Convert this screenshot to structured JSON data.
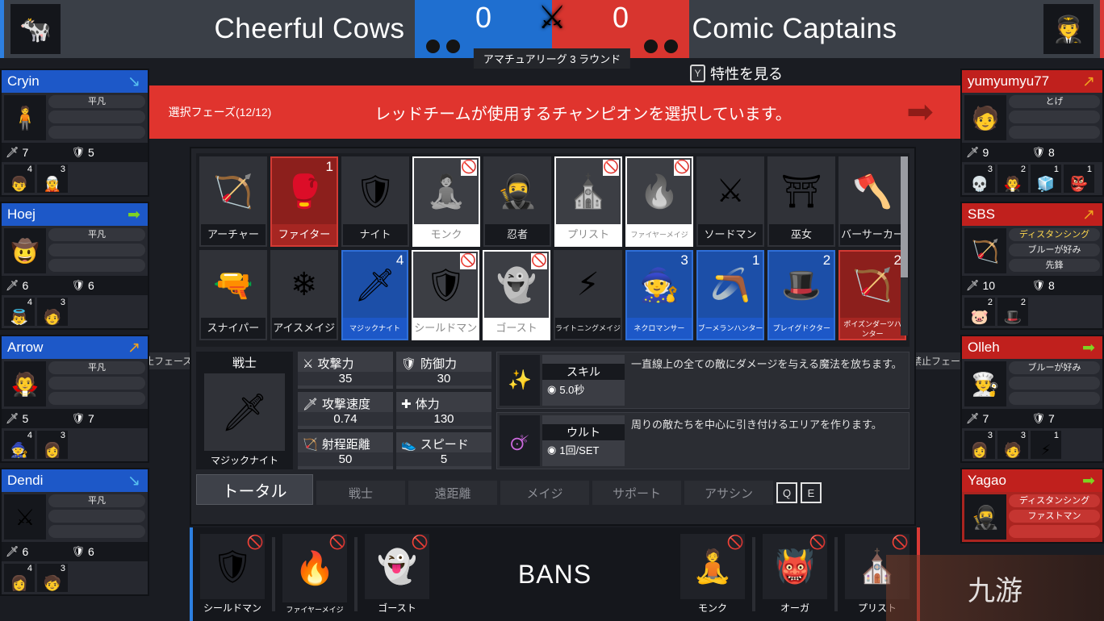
{
  "header": {
    "blue_team": "Cheerful Cows",
    "red_team": "Comic Captains",
    "blue_logo_icon": "cow-icon",
    "red_logo_icon": "captain-icon",
    "blue_score": "0",
    "red_score": "0",
    "swords_icon": "crossed-swords-icon",
    "league_label": "アマチュアリーグ 3 ラウンド",
    "trait_hint_key": "Y",
    "trait_hint_label": "特性を見る"
  },
  "phase": {
    "label": "選択フェーズ(12/12)",
    "message": "レッドチームが使用するチャンピオンを選択しています。",
    "arrow_icon": "arrow-right-icon",
    "ban_phase_tag": "禁止フェーズ"
  },
  "colors": {
    "blue": "#1d58c8",
    "red": "#c0201d",
    "banner_red": "#e0342e",
    "panel_dark": "#22242a"
  },
  "blue_players": [
    {
      "name": "Cryin",
      "arrow": "↘",
      "arrow_color": "#58c0f0",
      "traits": [
        "平凡",
        "",
        ""
      ],
      "atk": "7",
      "def": "5",
      "portrait": "🧍",
      "units": [
        {
          "icon": "👦",
          "count": "4"
        },
        {
          "icon": "🧝",
          "count": "3"
        }
      ]
    },
    {
      "name": "Hoej",
      "arrow": "➡",
      "arrow_color": "#7ed321",
      "traits": [
        "平凡",
        "",
        ""
      ],
      "atk": "6",
      "def": "6",
      "portrait": "🤠",
      "units": [
        {
          "icon": "👼",
          "count": "4"
        },
        {
          "icon": "🧑",
          "count": "3"
        }
      ]
    },
    {
      "name": "Arrow",
      "arrow": "↗",
      "arrow_color": "#f0a21e",
      "traits": [
        "平凡",
        "",
        ""
      ],
      "atk": "5",
      "def": "7",
      "portrait": "🧛",
      "units": [
        {
          "icon": "🧙",
          "count": "4"
        },
        {
          "icon": "👩",
          "count": "3"
        }
      ]
    },
    {
      "name": "Dendi",
      "arrow": "↘",
      "arrow_color": "#58c0f0",
      "traits": [
        "平凡",
        "",
        ""
      ],
      "atk": "6",
      "def": "6",
      "portrait": "⚔",
      "units": [
        {
          "icon": "👩",
          "count": "4"
        },
        {
          "icon": "🧒",
          "count": "3"
        }
      ]
    }
  ],
  "red_players": [
    {
      "name": "yumyumyu77",
      "arrow": "↗",
      "arrow_color": "#f0a21e",
      "traits": [
        "とげ",
        "",
        ""
      ],
      "atk": "9",
      "def": "8",
      "portrait": "🧑",
      "active": false,
      "units": [
        {
          "icon": "💀",
          "count": "3"
        },
        {
          "icon": "🧛",
          "count": "2"
        },
        {
          "icon": "🧊",
          "count": "1"
        },
        {
          "icon": "👺",
          "count": "1"
        }
      ]
    },
    {
      "name": "SBS",
      "arrow": "↗",
      "arrow_color": "#f0a21e",
      "traits": [
        "ディスタンシング",
        "ブルーが好み",
        "先鋒"
      ],
      "atk": "10",
      "def": "8",
      "portrait": "🏹",
      "active": false,
      "highlight_trait": 0,
      "units": [
        {
          "icon": "🐷",
          "count": "2"
        },
        {
          "icon": "🎩",
          "count": "2"
        }
      ]
    },
    {
      "name": "Olleh",
      "arrow": "➡",
      "arrow_color": "#7ed321",
      "traits": [
        "ブルーが好み",
        "",
        ""
      ],
      "atk": "7",
      "def": "7",
      "portrait": "👨‍🍳",
      "active": false,
      "units": [
        {
          "icon": "👩",
          "count": "3"
        },
        {
          "icon": "🧑",
          "count": "3"
        },
        {
          "icon": "⚡",
          "count": "1"
        }
      ]
    },
    {
      "name": "Yagao",
      "arrow": "➡",
      "arrow_color": "#7ed321",
      "traits": [
        "ディスタンシング",
        "ファストマン",
        ""
      ],
      "atk": "",
      "def": "",
      "portrait": "🥷",
      "active": true,
      "units": []
    }
  ],
  "champion_grid": {
    "row1": [
      {
        "name": "アーチャー",
        "icon": "🏹",
        "state": "normal",
        "count": ""
      },
      {
        "name": "ファイター",
        "icon": "🥊",
        "state": "selected-red",
        "count": "1"
      },
      {
        "name": "ナイト",
        "icon": "🛡",
        "state": "normal",
        "count": ""
      },
      {
        "name": "モンク",
        "icon": "🧘",
        "state": "banned",
        "count": ""
      },
      {
        "name": "忍者",
        "icon": "🥷",
        "state": "normal",
        "count": ""
      },
      {
        "name": "プリスト",
        "icon": "⛪",
        "state": "banned",
        "count": ""
      },
      {
        "name": "ファイヤーメイジ",
        "icon": "🔥",
        "state": "banned",
        "count": ""
      },
      {
        "name": "ソードマン",
        "icon": "⚔",
        "state": "normal",
        "count": ""
      },
      {
        "name": "巫女",
        "icon": "⛩",
        "state": "normal",
        "count": ""
      },
      {
        "name": "バーサーカー",
        "icon": "🪓",
        "state": "normal",
        "count": ""
      }
    ],
    "row2": [
      {
        "name": "スナイパー",
        "icon": "🔫",
        "state": "normal",
        "count": ""
      },
      {
        "name": "アイスメイジ",
        "icon": "❄",
        "state": "normal",
        "count": ""
      },
      {
        "name": "マジックナイト",
        "icon": "🗡",
        "state": "selected-blue",
        "count": "4"
      },
      {
        "name": "シールドマン",
        "icon": "🛡",
        "state": "banned",
        "count": ""
      },
      {
        "name": "ゴースト",
        "icon": "👻",
        "state": "banned",
        "count": ""
      },
      {
        "name": "ライトニングメイジ",
        "icon": "⚡",
        "state": "normal",
        "count": ""
      },
      {
        "name": "ネクロマンサー",
        "icon": "🧙",
        "state": "selected-blue",
        "count": "3"
      },
      {
        "name": "ブーメランハンター",
        "icon": "🪃",
        "state": "selected-blue",
        "count": "1"
      },
      {
        "name": "プレイグドクター",
        "icon": "🎩",
        "state": "selected-blue",
        "count": "2"
      },
      {
        "name": "ポイズンダーツハンター",
        "icon": "🏹",
        "state": "selected-red",
        "count": "2"
      }
    ]
  },
  "detail": {
    "class": "戦士",
    "char_name": "マジックナイト",
    "char_icon": "🗡",
    "stats": [
      {
        "icon": "⚔",
        "label": "攻撃力",
        "value": "35"
      },
      {
        "icon": "🗡",
        "label": "攻撃速度",
        "value": "0.74"
      },
      {
        "icon": "🏹",
        "label": "射程距離",
        "value": "50"
      },
      {
        "icon": "🛡",
        "label": "防御力",
        "value": "30"
      },
      {
        "icon": "✚",
        "label": "体力",
        "value": "130"
      },
      {
        "icon": "👟",
        "label": "スピード",
        "value": "5"
      }
    ],
    "skills": [
      {
        "icon": "✨",
        "title": "スキル",
        "cooldown": "5.0秒",
        "desc": "一直線上の全ての敵にダメージを与える魔法を放ちます。"
      },
      {
        "icon": "🜚",
        "title": "ウルト",
        "cooldown": "1回/SET",
        "desc": "周りの敵たちを中心に引き付けるエリアを作ります。"
      }
    ]
  },
  "tabs": {
    "items": [
      "トータル",
      "戦士",
      "遠距離",
      "メイジ",
      "サポート",
      "アサシン"
    ],
    "active_index": 0,
    "key_left": "Q",
    "key_right": "E"
  },
  "bans": {
    "title": "BANS",
    "blue": [
      {
        "name": "シールドマン",
        "icon": "🛡"
      },
      {
        "name": "ファイヤーメイジ",
        "icon": "🔥"
      },
      {
        "name": "ゴースト",
        "icon": "👻"
      }
    ],
    "red": [
      {
        "name": "モンク",
        "icon": "🧘"
      },
      {
        "name": "オーガ",
        "icon": "👹"
      },
      {
        "name": "プリスト",
        "icon": "⛪"
      }
    ],
    "ban_icon": "no-entry-icon"
  },
  "watermark": "九游"
}
